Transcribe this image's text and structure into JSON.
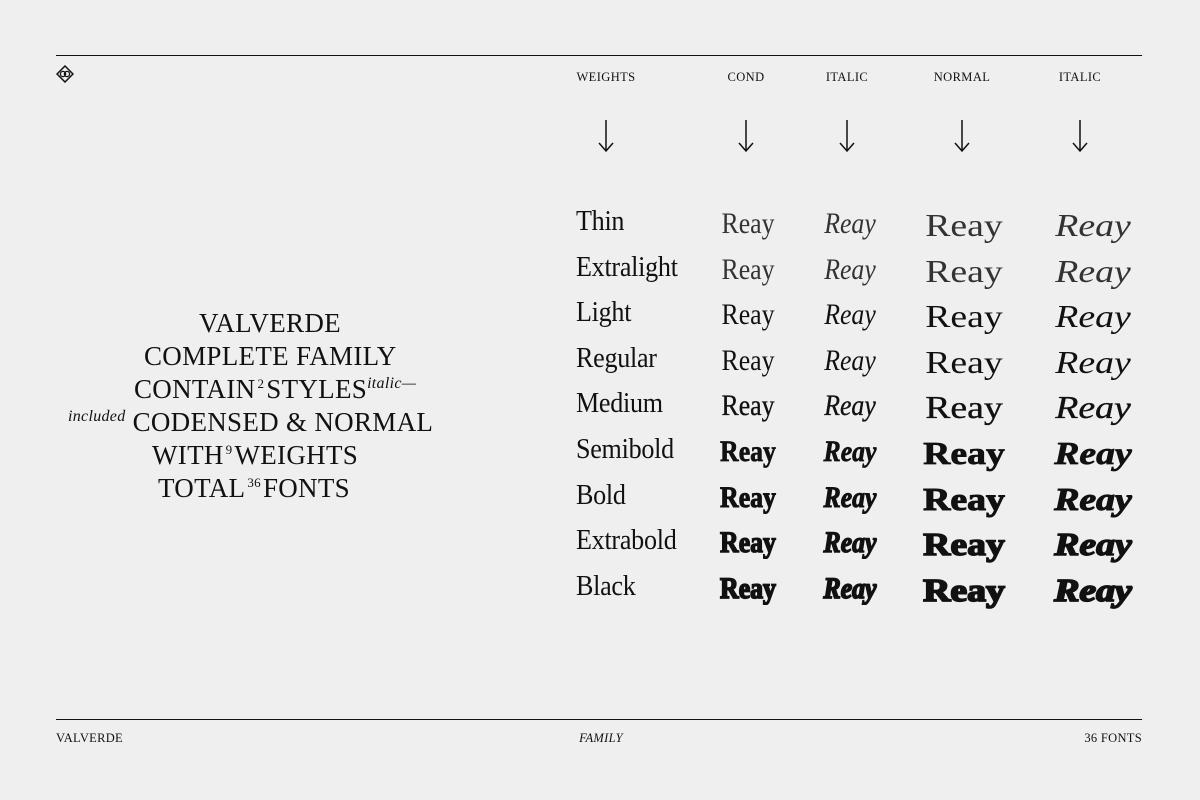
{
  "header": {
    "columns": [
      "WEIGHTS",
      "COND",
      "ITALIC",
      "NORMAL",
      "ITALIC"
    ]
  },
  "intro": {
    "line1": "VALVERDE",
    "line2": "COMPLETE FAMILY",
    "line3_pre": "CONTAIN",
    "line3_num": "2",
    "line3_post": "STYLES",
    "line3_italic": "italic—",
    "line4_italic": "included",
    "line4": "CODENSED & NORMAL",
    "line5_pre": "WITH",
    "line5_num": "9",
    "line5_post": "WEIGHTS",
    "line6_pre": "TOTAL",
    "line6_num": "36",
    "line6_post": "FONTS"
  },
  "specimen": {
    "sample_word": "Reay",
    "weights": [
      "Thin",
      "Extralight",
      "Light",
      "Regular",
      "Medium",
      "Semibold",
      "Bold",
      "Extrabold",
      "Black"
    ]
  },
  "footer": {
    "left": "VALVERDE",
    "center": "FAMILY",
    "right": "36 FONTS"
  },
  "icons": {
    "logo": "interlocking-diamond-logo-icon",
    "arrow": "arrow-down-icon"
  }
}
